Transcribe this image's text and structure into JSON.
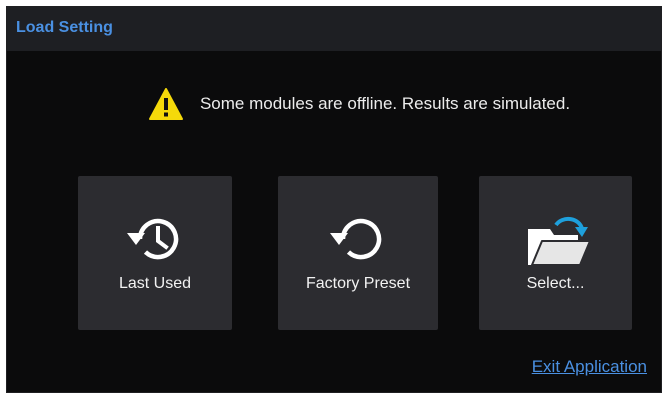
{
  "dialog": {
    "title": "Load Setting",
    "warning_icon": "warning-triangle-icon",
    "warning_text": "Some modules are offline. Results are simulated.",
    "tiles": [
      {
        "icon": "history-clock-icon",
        "label": "Last Used"
      },
      {
        "icon": "reset-arrow-icon",
        "label": "Factory Preset"
      },
      {
        "icon": "open-folder-icon",
        "label": "Select..."
      }
    ],
    "exit_label": "Exit Application"
  },
  "colors": {
    "background": "#0b0b0c",
    "titlebar": "#1e1f23",
    "tile": "#2c2c30",
    "accent": "#4a90e2",
    "warning": "#f5d90a",
    "folder_arrow": "#1ea0dc"
  }
}
